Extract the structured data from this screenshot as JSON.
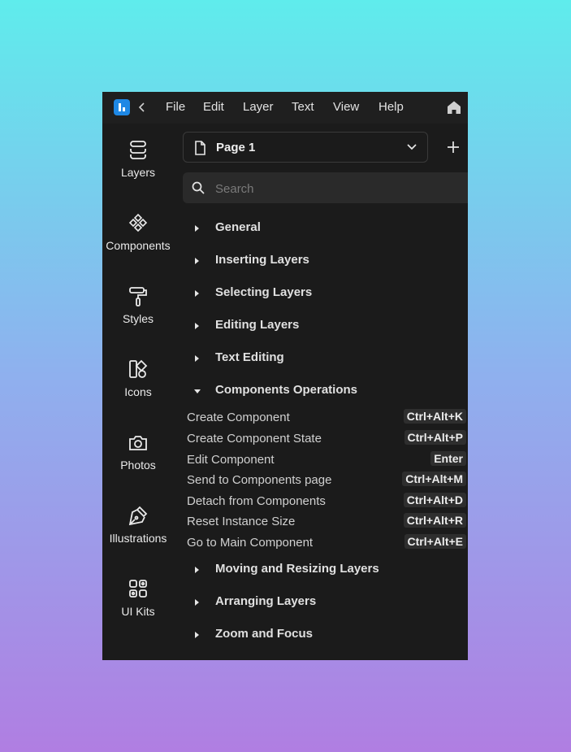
{
  "menubar": {
    "items": [
      "File",
      "Edit",
      "Layer",
      "Text",
      "View",
      "Help"
    ]
  },
  "rail": {
    "items": [
      {
        "label": "Layers",
        "icon": "layers-icon"
      },
      {
        "label": "Components",
        "icon": "components-icon"
      },
      {
        "label": "Styles",
        "icon": "paint-roller-icon"
      },
      {
        "label": "Icons",
        "icon": "shapes-icon"
      },
      {
        "label": "Photos",
        "icon": "camera-icon"
      },
      {
        "label": "Illustrations",
        "icon": "pen-nib-icon"
      },
      {
        "label": "UI Kits",
        "icon": "grid-icon"
      }
    ]
  },
  "page_select": {
    "label": "Page 1"
  },
  "search": {
    "placeholder": "Search",
    "value": ""
  },
  "sections_top": [
    "General",
    "Inserting Layers",
    "Selecting Layers",
    "Editing Layers",
    "Text Editing"
  ],
  "open_section": {
    "title": "Components Operations",
    "shortcuts": [
      {
        "name": "Create Component",
        "key": "Ctrl+Alt+K"
      },
      {
        "name": "Create Component State",
        "key": "Ctrl+Alt+P"
      },
      {
        "name": "Edit Component",
        "key": "Enter"
      },
      {
        "name": "Send to Components page",
        "key": "Ctrl+Alt+M"
      },
      {
        "name": "Detach from Components",
        "key": "Ctrl+Alt+D"
      },
      {
        "name": "Reset Instance Size",
        "key": "Ctrl+Alt+R"
      },
      {
        "name": "Go to Main Component",
        "key": "Ctrl+Alt+E"
      }
    ]
  },
  "sections_bottom": [
    "Moving and Resizing Layers",
    "Arranging Layers",
    "Zoom and Focus"
  ],
  "colors": {
    "accent": "#1e88e5",
    "panel": "#1b1b1b",
    "field": "#2a2a2a"
  }
}
